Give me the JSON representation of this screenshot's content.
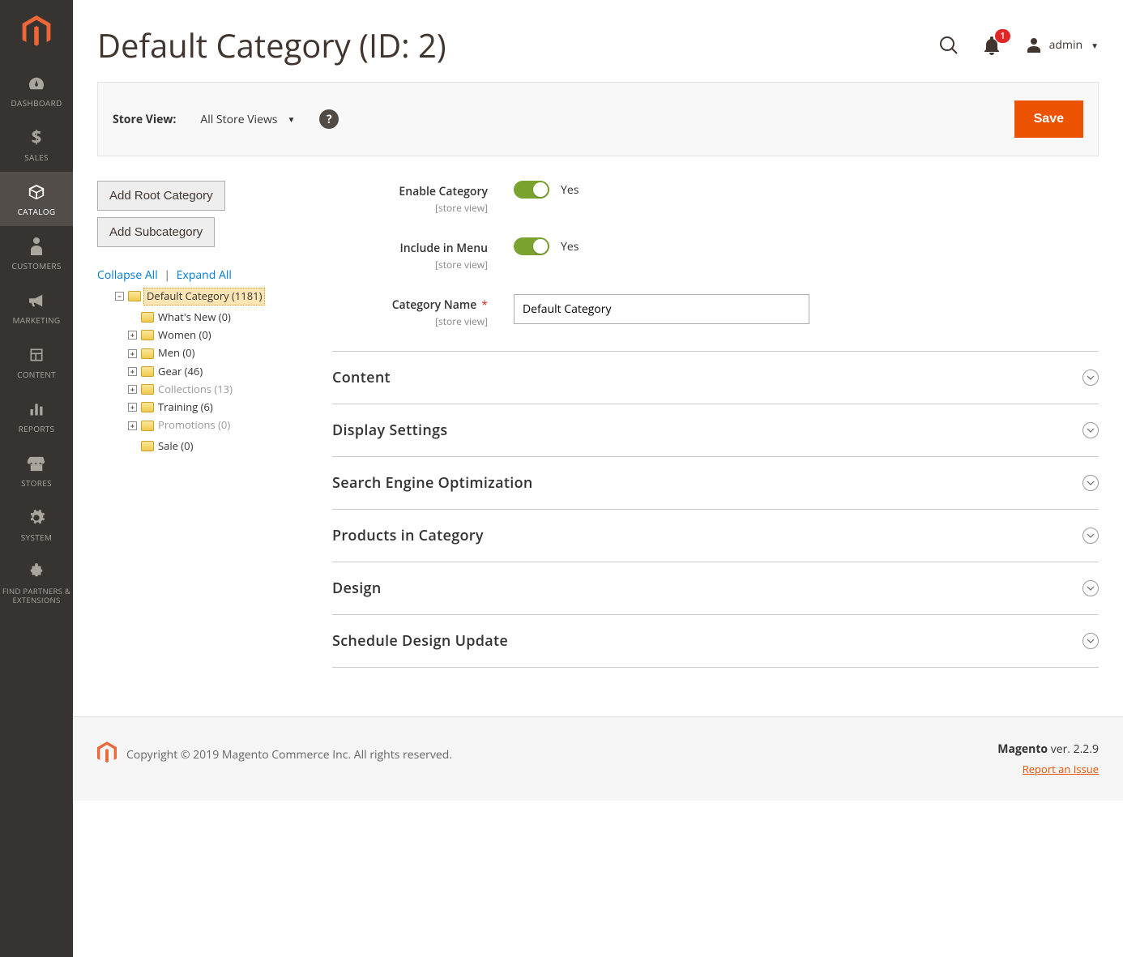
{
  "sidebar": {
    "items": [
      {
        "label": "DASHBOARD"
      },
      {
        "label": "SALES"
      },
      {
        "label": "CATALOG"
      },
      {
        "label": "CUSTOMERS"
      },
      {
        "label": "MARKETING"
      },
      {
        "label": "CONTENT"
      },
      {
        "label": "REPORTS"
      },
      {
        "label": "STORES"
      },
      {
        "label": "SYSTEM"
      },
      {
        "label": "FIND PARTNERS & EXTENSIONS"
      }
    ]
  },
  "header": {
    "title": "Default Category (ID: 2)",
    "notification_count": "1",
    "user": "admin"
  },
  "storebar": {
    "label": "Store View:",
    "value": "All Store Views",
    "save": "Save"
  },
  "leftcol": {
    "add_root": "Add Root Category",
    "add_sub": "Add Subcategory",
    "collapse": "Collapse All",
    "expand": "Expand All"
  },
  "tree": {
    "root": "Default Category (1181)",
    "children": [
      {
        "label": "What's New (0)",
        "expandable": false,
        "muted": false
      },
      {
        "label": "Women (0)",
        "expandable": true,
        "muted": false
      },
      {
        "label": "Men (0)",
        "expandable": true,
        "muted": false
      },
      {
        "label": "Gear (46)",
        "expandable": true,
        "muted": false
      },
      {
        "label": "Collections (13)",
        "expandable": true,
        "muted": true
      },
      {
        "label": "Training (6)",
        "expandable": true,
        "muted": false
      },
      {
        "label": "Promotions (0)",
        "expandable": true,
        "muted": true
      },
      {
        "label": "Sale (0)",
        "expandable": false,
        "muted": false
      }
    ]
  },
  "fields": {
    "enable_label": "Enable Category",
    "enable_value": "Yes",
    "menu_label": "Include in Menu",
    "menu_value": "Yes",
    "name_label": "Category Name",
    "name_value": "Default Category",
    "scope": "[store view]"
  },
  "accordions": [
    "Content",
    "Display Settings",
    "Search Engine Optimization",
    "Products in Category",
    "Design",
    "Schedule Design Update"
  ],
  "footer": {
    "copyright": "Copyright © 2019 Magento Commerce Inc. All rights reserved.",
    "product": "Magento",
    "version": " ver. 2.2.9",
    "report": "Report an Issue"
  }
}
